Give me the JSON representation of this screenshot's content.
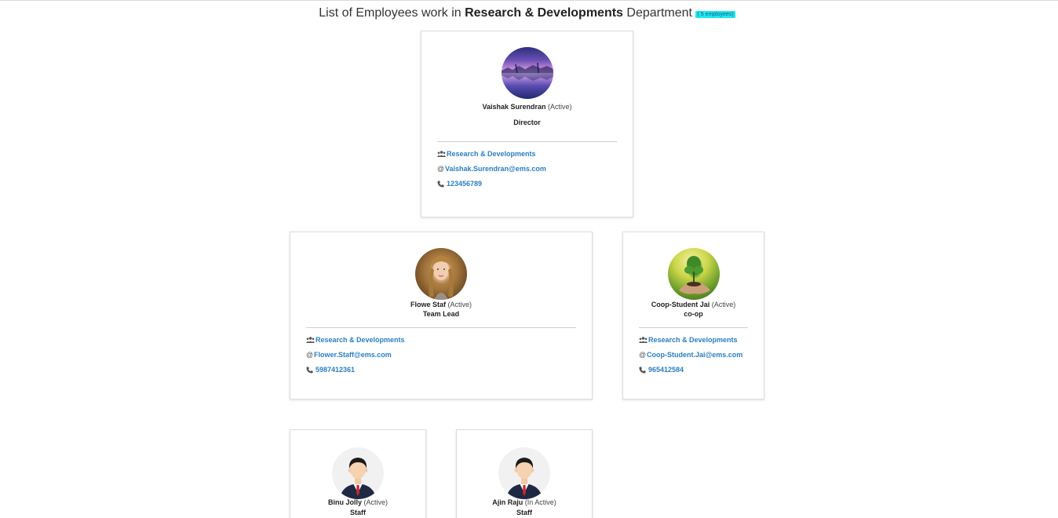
{
  "header": {
    "prefix": "List of Employees work in",
    "department": "Research & Developments",
    "suffix": "Department",
    "count_badge": "( 5 employees)"
  },
  "colors": {
    "link": "#2a7fc1",
    "badge_bg": "#1ee8ee"
  },
  "employees": [
    {
      "name": "Vaishak Surendran",
      "status": "(Active)",
      "role": "Director",
      "department": "Research & Developments",
      "email": "Vaishak.Surendran@ems.com",
      "phone": "123456789",
      "avatar": "lake-landscape-photo"
    },
    {
      "name": "Flowe Staf",
      "status": "(Active)",
      "role": "Team Lead",
      "department": "Research & Developments",
      "email": "Flower.Staff@ems.com",
      "phone": "5987412361",
      "avatar": "woman-portrait-photo"
    },
    {
      "name": "Coop-Student Jai",
      "status": "(Active)",
      "role": "co-op",
      "department": "Research & Developments",
      "email": "Coop-Student.Jai@ems.com",
      "phone": "965412584",
      "avatar": "plant-in-hand-photo"
    },
    {
      "name": "Binu Jolly",
      "status": "(Active)",
      "role": "Staff",
      "avatar": "businessman-icon"
    },
    {
      "name": "Ajin Raju",
      "status": "(In Active)",
      "role": "Staff",
      "avatar": "businessman-icon"
    }
  ]
}
